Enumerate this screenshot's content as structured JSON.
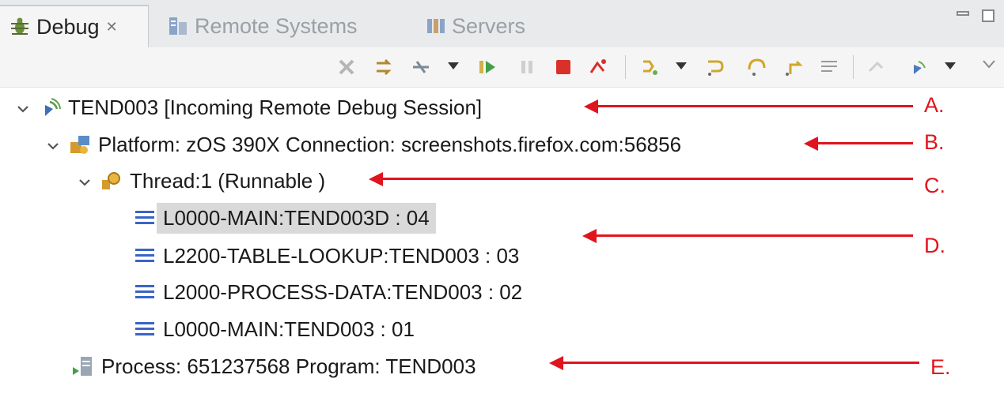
{
  "tabs": [
    {
      "label": "Debug",
      "close": "✕",
      "icon": "bug-icon",
      "active": true
    },
    {
      "label": "Remote Systems",
      "icon": "remote-systems-icon",
      "active": false
    },
    {
      "label": "Servers",
      "icon": "servers-icon",
      "active": false
    }
  ],
  "toolbar": {
    "buttons": [
      "remove-launches-icon",
      "connect-icon",
      "disconnect-icon",
      "dropdown",
      "resume-icon",
      "suspend-icon",
      "terminate-icon",
      "terminate-disconnect-icon",
      "step-filter-icon",
      "dropdown",
      "step-into-icon",
      "step-over-icon",
      "step-return-icon",
      "instruction-step-icon",
      "use-step-filters-icon",
      "debug-remote-icon",
      "dropdown",
      "view-menu-icon"
    ]
  },
  "tree": {
    "session": {
      "label": "TEND003 [Incoming Remote Debug Session]",
      "icon": "remote-debug-icon"
    },
    "platform": {
      "label": "Platform: zOS 390X   Connection: screenshots.firefox.com:56856",
      "icon": "platform-icon"
    },
    "thread": {
      "label": "Thread:1 (Runnable )",
      "icon": "thread-icon"
    },
    "frames": [
      {
        "label": "L0000-MAIN:TEND003D : 04",
        "selected": true
      },
      {
        "label": "L2200-TABLE-LOOKUP:TEND003 : 03",
        "selected": false
      },
      {
        "label": "L2000-PROCESS-DATA:TEND003 : 02",
        "selected": false
      },
      {
        "label": "L0000-MAIN:TEND003 : 01",
        "selected": false
      }
    ],
    "process": {
      "label": "Process: 651237568  Program: TEND003",
      "icon": "process-icon"
    }
  },
  "annotations": {
    "A": "A.",
    "B": "B.",
    "C": "C.",
    "D": "D.",
    "E": "E."
  },
  "colors": {
    "annotation": "#e0141e",
    "selection": "#d9d9d9",
    "stack_frame_icon": "#3a64c8"
  }
}
